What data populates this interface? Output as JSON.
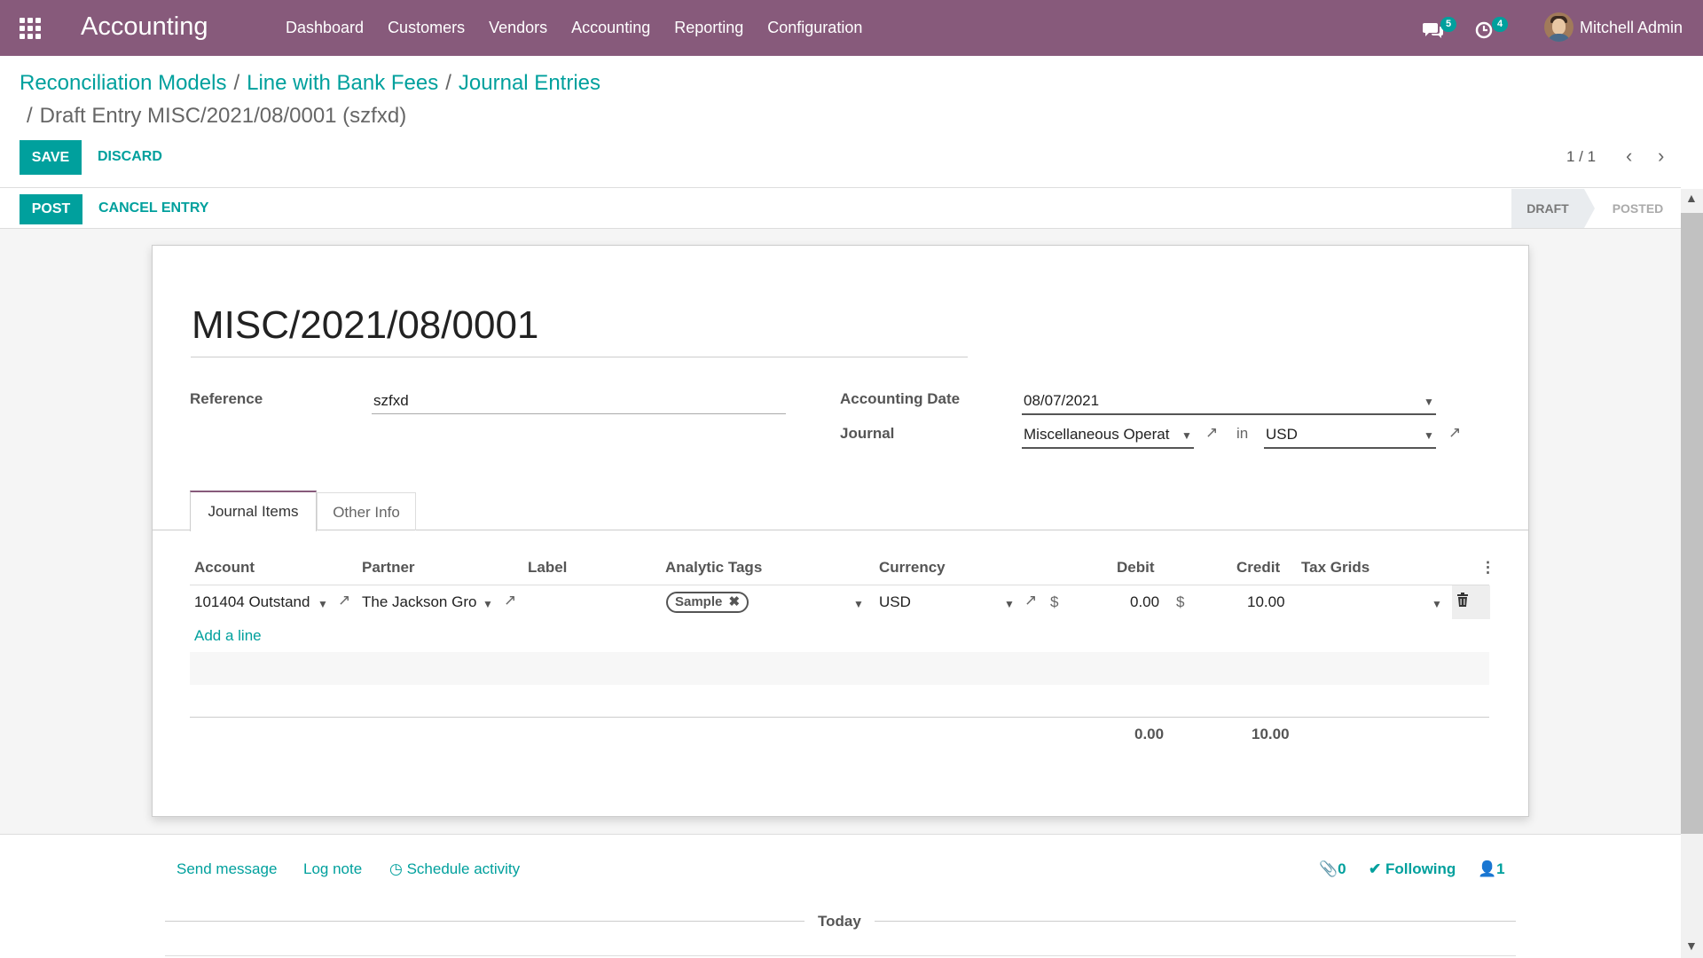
{
  "app": {
    "title": "Accounting",
    "menu": [
      "Dashboard",
      "Customers",
      "Vendors",
      "Accounting",
      "Reporting",
      "Configuration"
    ],
    "chat_count": "5",
    "activity_count": "4",
    "user": "Mitchell Admin"
  },
  "breadcrumb": {
    "items": [
      "Reconciliation Models",
      "Line with Bank Fees",
      "Journal Entries"
    ],
    "current": "Draft Entry MISC/2021/08/0001 (szfxd)"
  },
  "control": {
    "save": "SAVE",
    "discard": "DISCARD",
    "pager": "1 / 1"
  },
  "header": {
    "post": "POST",
    "cancel": "CANCEL ENTRY",
    "statuses": [
      "DRAFT",
      "POSTED"
    ],
    "active_status": "DRAFT"
  },
  "form": {
    "name": "MISC/2021/08/0001",
    "reference_label": "Reference",
    "reference": "szfxd",
    "date_label": "Accounting Date",
    "date": "08/07/2021",
    "journal_label": "Journal",
    "journal": "Miscellaneous Operat",
    "in_word": "in",
    "currency": "USD"
  },
  "tabs": [
    "Journal Items",
    "Other Info"
  ],
  "table": {
    "headers": [
      "Account",
      "Partner",
      "Label",
      "Analytic Tags",
      "Currency",
      "Debit",
      "Credit",
      "Tax Grids"
    ],
    "row": {
      "account": "101404 Outstand",
      "partner": "The Jackson Gro",
      "label": "",
      "tag": "Sample",
      "currency": "USD",
      "debit_symbol": "$",
      "debit": "0.00",
      "credit_symbol": "$",
      "credit": "10.00"
    },
    "add_line": "Add a line",
    "total_debit": "0.00",
    "total_credit": "10.00"
  },
  "chatter": {
    "send_message": "Send message",
    "log_note": "Log note",
    "schedule_activity": "Schedule activity",
    "attachments": "0",
    "following": "Following",
    "followers": "1",
    "today": "Today"
  },
  "colors": {
    "brand": "#875a7b",
    "accent": "#00a09d"
  }
}
